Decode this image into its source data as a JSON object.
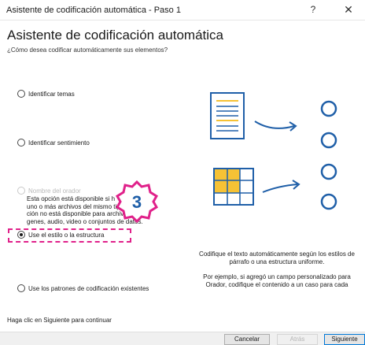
{
  "window": {
    "title": "Asistente de codificación automática - Paso 1",
    "help_label": "?",
    "close_label": "✕"
  },
  "main": {
    "heading": "Asistente de codificación automática",
    "question": "¿Cómo desea codificar automáticamente sus elementos?",
    "options": [
      {
        "label": "Identificar temas",
        "checked": false,
        "disabled": false
      },
      {
        "label": "Identificar sentimiento",
        "checked": false,
        "disabled": false
      },
      {
        "label": "Nombre del orador",
        "checked": false,
        "disabled": true
      },
      {
        "label": "Use el estilo o la estructura",
        "checked": true,
        "disabled": false
      },
      {
        "label": "Use los patrones de codificación existentes",
        "checked": false,
        "disabled": false
      }
    ],
    "speaker_description_parts": [
      "Esta opción está disponible si h",
      "uno o más archivos del mismo tipo de ",
      "ción no está disponible para archivos e",
      "genes, audio, video o conjuntos de datos."
    ],
    "footer_hint": "Haga clic en Siguiente para continuar"
  },
  "annotation": {
    "step_number": "3",
    "accent_color": "#e0218a"
  },
  "illustration": {
    "doc_icon": "document-icon",
    "table_icon": "table-icon",
    "arrow_icon": "arrow-right-icon",
    "node_icon": "circle-node-icon",
    "primary_color": "#1f5fa8",
    "secondary_color": "#f6c235"
  },
  "right_panel": {
    "text1": "Codifique el texto automáticamente según los estilos de párrafo o una estructura uniforme.",
    "text2": "Por ejemplo, si agregó un campo personalizado para Orador, codifique el contenido a un caso para cada"
  },
  "buttons": {
    "cancel": "Cancelar",
    "back": "Atrás",
    "next": "Siguiente"
  }
}
